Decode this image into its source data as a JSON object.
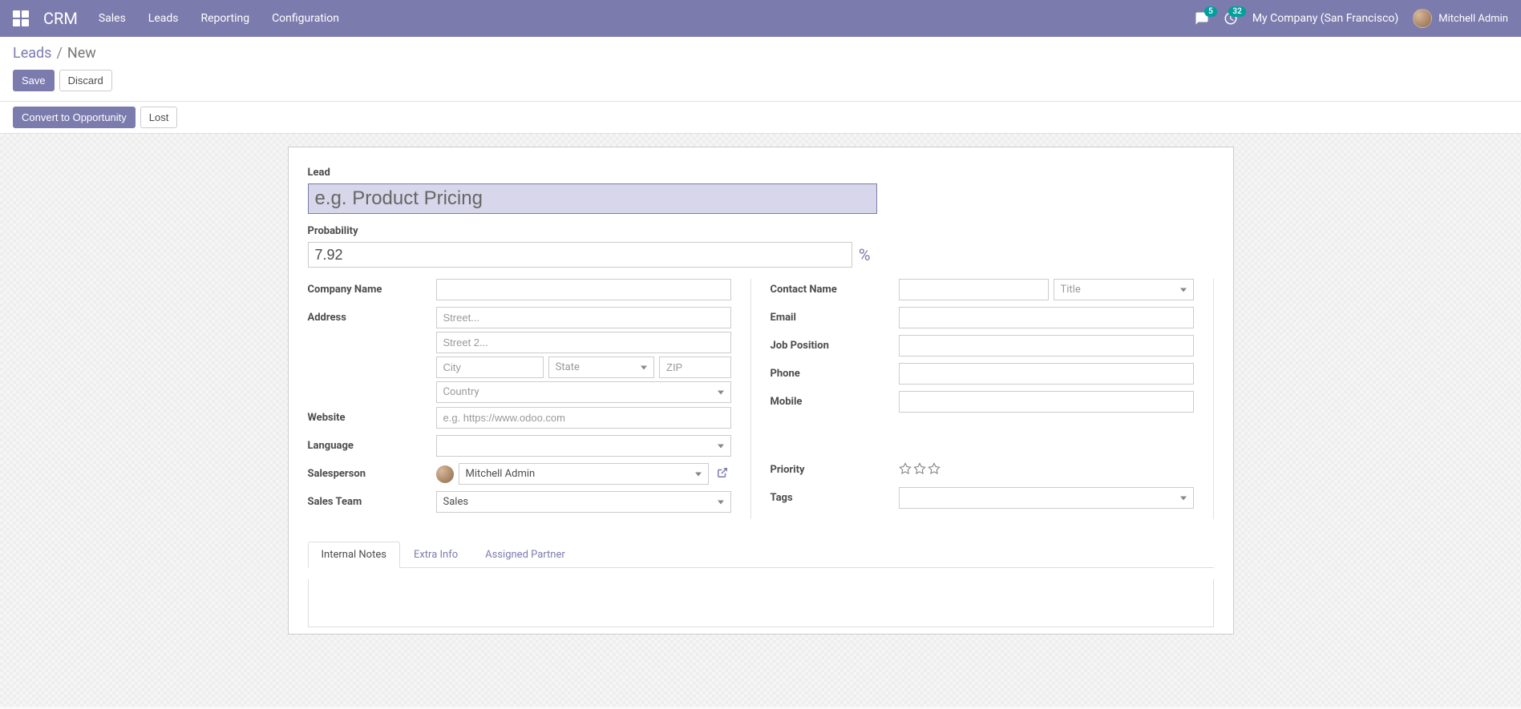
{
  "navbar": {
    "brand": "CRM",
    "links": [
      "Sales",
      "Leads",
      "Reporting",
      "Configuration"
    ],
    "messages_count": "5",
    "activities_count": "32",
    "company": "My Company (San Francisco)",
    "user": "Mitchell Admin"
  },
  "breadcrumb": {
    "parent": "Leads",
    "current": "New"
  },
  "buttons": {
    "save": "Save",
    "discard": "Discard",
    "convert": "Convert to Opportunity",
    "lost": "Lost"
  },
  "form": {
    "lead_label": "Lead",
    "lead_placeholder": "e.g. Product Pricing",
    "lead_value": "",
    "probability_label": "Probability",
    "probability_value": "7.92",
    "percent": "%",
    "left": {
      "company_name_label": "Company Name",
      "company_name_value": "",
      "address_label": "Address",
      "street_placeholder": "Street...",
      "street2_placeholder": "Street 2...",
      "city_placeholder": "City",
      "state_placeholder": "State",
      "zip_placeholder": "ZIP",
      "country_placeholder": "Country",
      "website_label": "Website",
      "website_placeholder": "e.g. https://www.odoo.com",
      "language_label": "Language",
      "salesperson_label": "Salesperson",
      "salesperson_value": "Mitchell Admin",
      "sales_team_label": "Sales Team",
      "sales_team_value": "Sales"
    },
    "right": {
      "contact_name_label": "Contact Name",
      "contact_name_value": "",
      "title_placeholder": "Title",
      "email_label": "Email",
      "job_position_label": "Job Position",
      "phone_label": "Phone",
      "mobile_label": "Mobile",
      "priority_label": "Priority",
      "tags_label": "Tags"
    }
  },
  "tabs": {
    "internal_notes": "Internal Notes",
    "extra_info": "Extra Info",
    "assigned_partner": "Assigned Partner"
  }
}
